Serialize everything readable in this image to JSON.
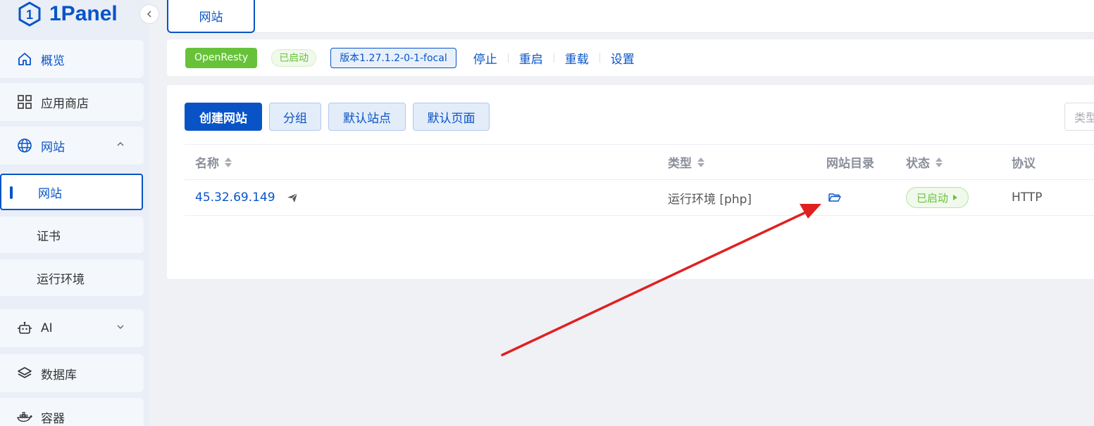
{
  "app": {
    "logo_text": "1Panel"
  },
  "sidebar": {
    "items": [
      {
        "label": "概览",
        "icon": "home-icon"
      },
      {
        "label": "应用商店",
        "icon": "grid-icon"
      },
      {
        "label": "网站",
        "icon": "globe-icon",
        "expanded": true,
        "children": [
          {
            "label": "网站",
            "active": true
          },
          {
            "label": "证书"
          },
          {
            "label": "运行环境"
          }
        ]
      },
      {
        "label": "AI",
        "icon": "robot-icon"
      },
      {
        "label": "数据库",
        "icon": "layers-icon"
      },
      {
        "label": "容器",
        "icon": "docker-icon"
      }
    ]
  },
  "tabs": [
    {
      "label": "网站",
      "active": true
    }
  ],
  "appbar": {
    "app_name": "OpenResty",
    "status": "已启动",
    "version": "版本1.27.1.2-0-1-focal",
    "actions": [
      "停止",
      "重启",
      "重载",
      "设置"
    ]
  },
  "toolbar": {
    "create": "创建网站",
    "group": "分组",
    "default_site": "默认站点",
    "default_page": "默认页面",
    "type_placeholder": "类型"
  },
  "table": {
    "columns": [
      "名称",
      "类型",
      "网站目录",
      "状态",
      "协议"
    ],
    "rows": [
      {
        "name": "45.32.69.149",
        "type": "运行环境 [php]",
        "status": "已启动",
        "protocol": "HTTP"
      }
    ]
  },
  "colors": {
    "accent": "#0854c7",
    "success": "#67c23a",
    "annotation": "#e02020"
  }
}
